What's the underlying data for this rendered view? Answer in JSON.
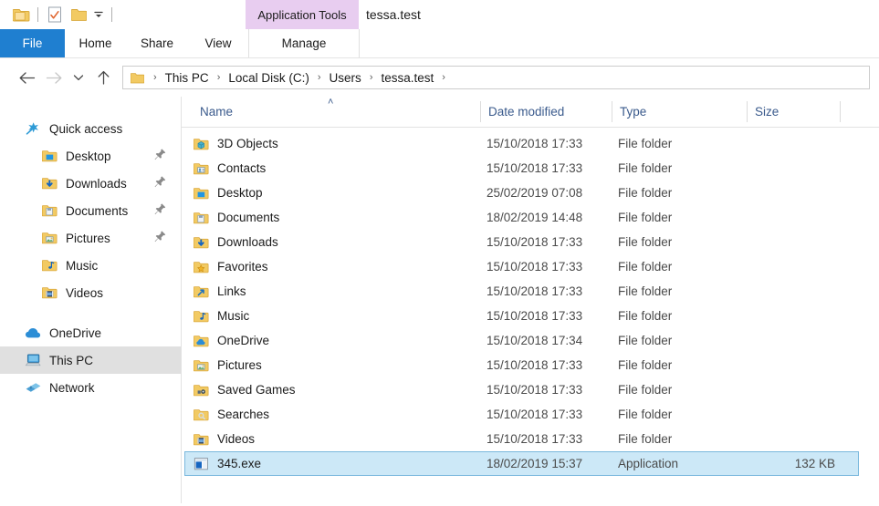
{
  "window": {
    "title": "tessa.test",
    "contextual_tab_header": "Application Tools"
  },
  "quick_access_toolbar": {
    "items": [
      {
        "icon": "folder-icon",
        "name": "explorer-folder-icon"
      },
      {
        "icon": "properties-icon",
        "name": "properties-icon"
      },
      {
        "icon": "new-folder-icon",
        "name": "new-folder-icon"
      }
    ],
    "customize_label": "▾"
  },
  "ribbon": {
    "tabs": [
      {
        "label": "File",
        "selected": true
      },
      {
        "label": "Home",
        "selected": false
      },
      {
        "label": "Share",
        "selected": false
      },
      {
        "label": "View",
        "selected": false
      }
    ],
    "contextual_tabs": [
      {
        "label": "Manage",
        "selected": false
      }
    ]
  },
  "navigation": {
    "back_label": "←",
    "forward_label": "→",
    "recent_label": "⌄",
    "up_label": "↑"
  },
  "address_bar": {
    "separator": "›",
    "crumbs": [
      "This PC",
      "Local Disk (C:)",
      "Users",
      "tessa.test"
    ]
  },
  "sidebar": {
    "items": [
      {
        "label": "Quick access",
        "icon": "star-icon",
        "level": 0,
        "pinned": false,
        "selected": false
      },
      {
        "label": "Desktop",
        "icon": "folder-desktop-icon",
        "level": 1,
        "pinned": true,
        "selected": false
      },
      {
        "label": "Downloads",
        "icon": "folder-downloads-icon",
        "level": 1,
        "pinned": true,
        "selected": false
      },
      {
        "label": "Documents",
        "icon": "folder-documents-icon",
        "level": 1,
        "pinned": true,
        "selected": false
      },
      {
        "label": "Pictures",
        "icon": "folder-pictures-icon",
        "level": 1,
        "pinned": true,
        "selected": false
      },
      {
        "label": "Music",
        "icon": "folder-music-icon",
        "level": 1,
        "pinned": false,
        "selected": false
      },
      {
        "label": "Videos",
        "icon": "folder-videos-icon",
        "level": 1,
        "pinned": false,
        "selected": false
      },
      {
        "label": "OneDrive",
        "icon": "cloud-icon",
        "level": 0,
        "pinned": false,
        "selected": false
      },
      {
        "label": "This PC",
        "icon": "computer-icon",
        "level": 0,
        "pinned": false,
        "selected": true
      },
      {
        "label": "Network",
        "icon": "network-icon",
        "level": 0,
        "pinned": false,
        "selected": false
      }
    ]
  },
  "file_list": {
    "columns": [
      {
        "label": "Name",
        "sorted": true,
        "sort_direction": "ascending",
        "sort_caret": "˄"
      },
      {
        "label": "Date modified",
        "sorted": false
      },
      {
        "label": "Type",
        "sorted": false
      },
      {
        "label": "Size",
        "sorted": false
      }
    ],
    "rows": [
      {
        "name": "3D Objects",
        "date": "15/10/2018 17:33",
        "type": "File folder",
        "size": "",
        "icon": "folder-3dobjects-icon",
        "selected": false
      },
      {
        "name": "Contacts",
        "date": "15/10/2018 17:33",
        "type": "File folder",
        "size": "",
        "icon": "folder-contacts-icon",
        "selected": false
      },
      {
        "name": "Desktop",
        "date": "25/02/2019 07:08",
        "type": "File folder",
        "size": "",
        "icon": "folder-desktop-icon",
        "selected": false
      },
      {
        "name": "Documents",
        "date": "18/02/2019 14:48",
        "type": "File folder",
        "size": "",
        "icon": "folder-documents-icon",
        "selected": false
      },
      {
        "name": "Downloads",
        "date": "15/10/2018 17:33",
        "type": "File folder",
        "size": "",
        "icon": "folder-downloads-icon",
        "selected": false
      },
      {
        "name": "Favorites",
        "date": "15/10/2018 17:33",
        "type": "File folder",
        "size": "",
        "icon": "folder-favorites-icon",
        "selected": false
      },
      {
        "name": "Links",
        "date": "15/10/2018 17:33",
        "type": "File folder",
        "size": "",
        "icon": "folder-links-icon",
        "selected": false
      },
      {
        "name": "Music",
        "date": "15/10/2018 17:33",
        "type": "File folder",
        "size": "",
        "icon": "folder-music-icon",
        "selected": false
      },
      {
        "name": "OneDrive",
        "date": "15/10/2018 17:34",
        "type": "File folder",
        "size": "",
        "icon": "folder-onedrive-icon",
        "selected": false
      },
      {
        "name": "Pictures",
        "date": "15/10/2018 17:33",
        "type": "File folder",
        "size": "",
        "icon": "folder-pictures-icon",
        "selected": false
      },
      {
        "name": "Saved Games",
        "date": "15/10/2018 17:33",
        "type": "File folder",
        "size": "",
        "icon": "folder-savedgames-icon",
        "selected": false
      },
      {
        "name": "Searches",
        "date": "15/10/2018 17:33",
        "type": "File folder",
        "size": "",
        "icon": "folder-searches-icon",
        "selected": false
      },
      {
        "name": "Videos",
        "date": "15/10/2018 17:33",
        "type": "File folder",
        "size": "",
        "icon": "folder-videos-icon",
        "selected": false
      },
      {
        "name": "345.exe",
        "date": "18/02/2019 15:37",
        "type": "Application",
        "size": "132 KB",
        "icon": "application-exe-icon",
        "selected": true
      }
    ]
  },
  "colors": {
    "accent": "#1f7fd0",
    "contextual_tab": "#e8cdf0",
    "selection_fill": "#cce8f7",
    "selection_border": "#7ab8dd",
    "sidebar_selection": "#e0e0e0",
    "column_header_text": "#3a5a8c",
    "folder_yellow": "#f7c34b"
  }
}
